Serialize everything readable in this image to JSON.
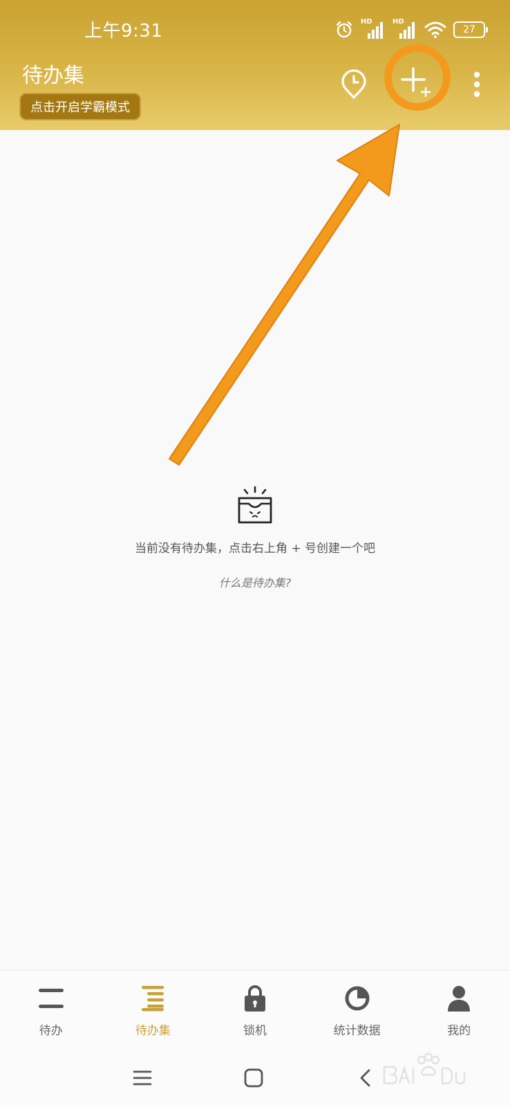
{
  "status_bar": {
    "time": "上午9:31",
    "signal_1_label": "HD",
    "signal_2_label": "HD",
    "battery": "27"
  },
  "header": {
    "title": "待办集",
    "study_mode_label": "点击开启学霸模式",
    "icons": [
      "clock-icon",
      "add-icon",
      "more-icon"
    ]
  },
  "empty_state": {
    "icon": "empty-inbox-icon",
    "message": "当前没有待办集，点击右上角 + 号创建一个吧",
    "help_link": "什么是待办集?"
  },
  "bottom_nav": {
    "items": [
      {
        "label": "待办",
        "icon": "todo-icon"
      },
      {
        "label": "待办集",
        "icon": "todo-collection-icon"
      },
      {
        "label": "锁机",
        "icon": "lock-icon"
      },
      {
        "label": "统计数据",
        "icon": "stats-icon"
      },
      {
        "label": "我的",
        "icon": "profile-icon"
      }
    ],
    "active_index": 1
  },
  "system_nav": {
    "icons": [
      "menu-icon",
      "home-icon",
      "back-icon"
    ]
  },
  "colors": {
    "header": "#d4ad3e",
    "accent": "#c9a13a",
    "annotation": "#f39a1c",
    "background": "#f9f9f9"
  }
}
